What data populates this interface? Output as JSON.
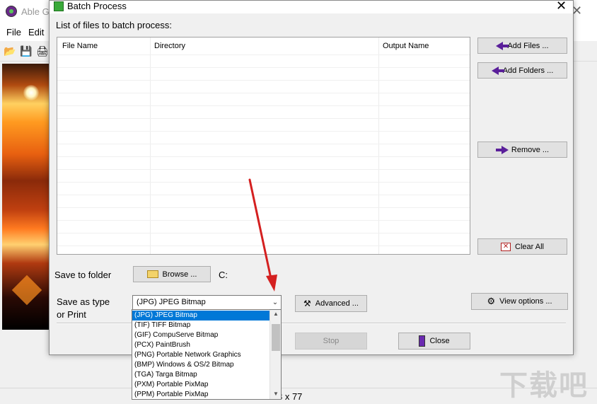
{
  "background_app": {
    "title": "Able G",
    "menu": [
      "File",
      "Edit"
    ],
    "status_text": "3 x 77",
    "watermark": "下载吧"
  },
  "dialog": {
    "title": "Batch Process",
    "list_label": "List of files to batch process:",
    "columns": [
      "File Name",
      "Directory",
      "Output Name"
    ],
    "buttons": {
      "add_files": "Add Files ...",
      "add_folders": "Add Folders ...",
      "remove": "Remove ...",
      "clear_all": "Clear All",
      "browse": "Browse ...",
      "advanced": "Advanced ...",
      "view_options": "View options ...",
      "stop": "Stop",
      "close": "Close"
    },
    "save_folder_label": "Save to folder",
    "save_folder_path": "C:",
    "save_type_label": [
      "Save as type",
      "or Print"
    ],
    "save_type_selected": "(JPG) JPEG Bitmap",
    "save_type_options": [
      "(JPG) JPEG Bitmap",
      "(TIF) TIFF Bitmap",
      "(GIF) CompuServe Bitmap",
      "(PCX) PaintBrush",
      "(PNG) Portable Network Graphics",
      "(BMP) Windows & OS/2 Bitmap",
      "(TGA) Targa Bitmap",
      "(PXM) Portable PixMap",
      "(PPM) Portable PixMap"
    ]
  },
  "colors": {
    "accent_selection": "#0078d7",
    "annotation_arrow": "#d42020",
    "button_arrow": "#5a1f9a"
  }
}
